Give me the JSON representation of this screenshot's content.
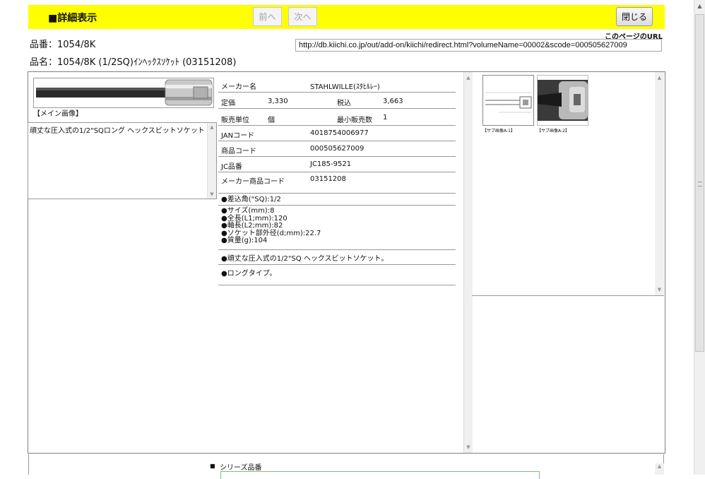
{
  "toolbar": {
    "title": "■詳細表示",
    "prev": "前へ",
    "next": "次へ",
    "close": "閉じる"
  },
  "header": {
    "hinban": "品番：1054/8K",
    "hinmei": "品名：1054/8K (1/2SQ)ｲﾝﾍｯｸｽｿｹｯﾄ (03151208)",
    "url_label": "このページのURL",
    "url": "http://db.kiichi.co.jp/out/add-on/kiichi/redirect.html?volumeName=00002&scode=000505627009"
  },
  "main_image": {
    "label": "【メイン画像】"
  },
  "description": "頑丈な圧入式の1/2\"SQロング ヘックスビットソケット",
  "specs": {
    "maker_label": "メーカー名",
    "maker": "STAHLWILLE(ｽﾀﾋﾙﾚｰ)",
    "teika_label": "定価",
    "teika": "3,330",
    "zeikomi_label": "税込",
    "zeikomi": "3,663",
    "unit_label": "販売単位",
    "unit": "個",
    "min_label": "最小販売数",
    "min": "1",
    "jan_label": "JANコード",
    "jan": "4018754006977",
    "code_label": "商品コード",
    "code": "000505627009",
    "jc_label": "JC品番",
    "jc": "JC185-9521",
    "mcode_label": "メーカー商品コード",
    "mcode": "03151208"
  },
  "attributes": {
    "sq": "●差込角(\"SQ):1/2",
    "size": "●サイズ(mm):8",
    "length": "●全長(L1;mm):120",
    "shaft": "●軸長(L2;mm):82",
    "outer": "●ソケット部外径(d;mm):22.7",
    "weight": "●質量(g):104",
    "feature1": "●頑丈な圧入式の1/2\"SQ ヘックスビットソケット。",
    "feature2": "●ロングタイプ。"
  },
  "sub_images": {
    "label1": "【サブ画像A-1】",
    "label2": "【サブ画像A-2】"
  },
  "series": {
    "label": "シリーズ品番"
  },
  "colors": {
    "toolbar_bg": "#ffff00",
    "series_border": "#7bbf7b"
  }
}
